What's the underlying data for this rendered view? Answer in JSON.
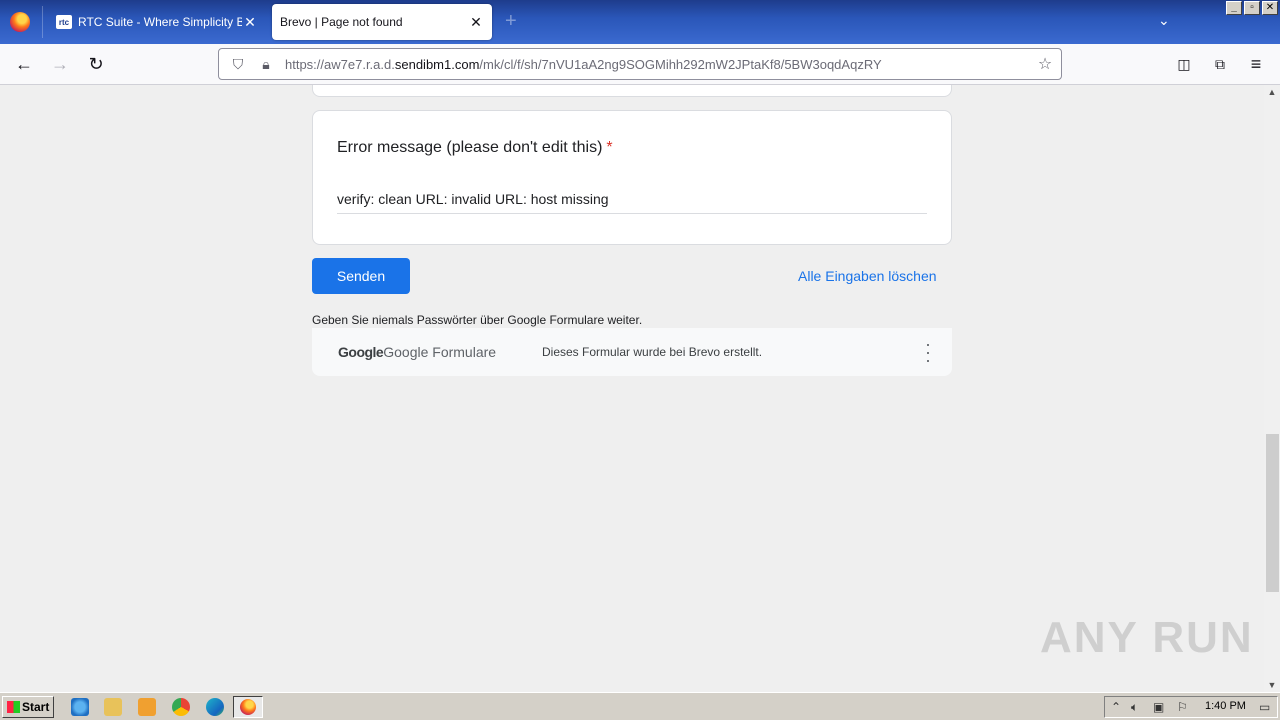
{
  "browser": {
    "tabs": [
      {
        "title": "RTC Suite - Where Simplicity Builds",
        "favicon": "rtc",
        "active": false
      },
      {
        "title": "Brevo | Page not found",
        "active": true
      }
    ],
    "url": {
      "prefix": "https://aw7e7.r.a.d.",
      "host": "sendibm1.com",
      "path": "/mk/cl/f/sh/7nVU1aA2ng9SOGMihh292mW2JPtaKf8/5BW3oqdAqzRY"
    }
  },
  "form": {
    "question_title": "Error message (please don't edit this)",
    "required_marker": "*",
    "answer": "verify: clean URL: invalid URL: host missing",
    "submit_label": "Senden",
    "clear_label": "Alle Eingaben löschen",
    "password_note": "Geben Sie niemals Passwörter über Google Formulare weiter.",
    "footer_brand_google": "Google",
    "footer_brand_product": "Google Formulare",
    "footer_created": "Dieses Formular wurde bei Brevo erstellt."
  },
  "watermark": "ANY RUN",
  "taskbar": {
    "start_label": "Start",
    "clock": "1:40 PM"
  },
  "colors": {
    "accent": "#1a73e8",
    "required": "#d93025",
    "titlebar": "#2a56b8"
  }
}
